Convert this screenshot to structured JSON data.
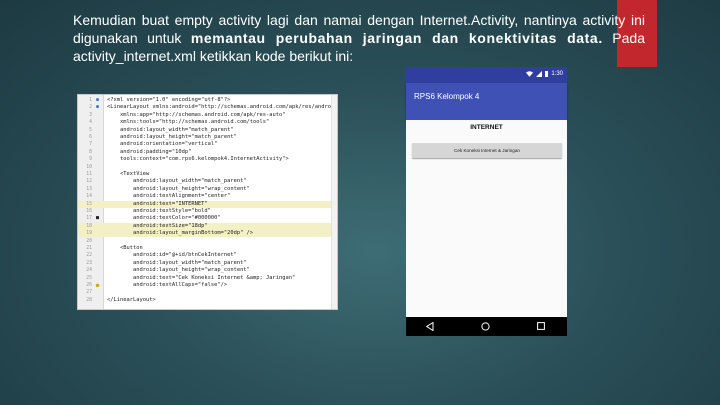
{
  "intro": {
    "line1": "Kemudian buat empty activity lagi dan namai dengan Internet.Activity, nantinya activity",
    "line2a": "ini digunakan untuk ",
    "line2b": "memantau perubahan jaringan dan konektivitas data.",
    "line2c": " Pada",
    "line3": "activity_internet.xml ketikkan kode berikut ini:"
  },
  "editor": {
    "lines": [
      {
        "n": "1",
        "text": "<?xml version=\"1.0\" encoding=\"utf-8\"?>"
      },
      {
        "n": "2",
        "text": "<LinearLayout xmlns:android=\"http://schemas.android.com/apk/res/android\""
      },
      {
        "n": "3",
        "text": "    xmlns:app=\"http://schemas.android.com/apk/res-auto\""
      },
      {
        "n": "4",
        "text": "    xmlns:tools=\"http://schemas.android.com/tools\""
      },
      {
        "n": "5",
        "text": "    android:layout_width=\"match_parent\""
      },
      {
        "n": "6",
        "text": "    android:layout_height=\"match_parent\""
      },
      {
        "n": "7",
        "text": "    android:orientation=\"vertical\""
      },
      {
        "n": "8",
        "text": "    android:padding=\"10dp\""
      },
      {
        "n": "9",
        "text": "    tools:context=\"com.rps6.kelompok4.InternetActivity\">"
      },
      {
        "n": "10",
        "text": ""
      },
      {
        "n": "11",
        "text": "    <TextView"
      },
      {
        "n": "12",
        "text": "        android:layout_width=\"match_parent\""
      },
      {
        "n": "13",
        "text": "        android:layout_height=\"wrap_content\""
      },
      {
        "n": "14",
        "text": "        android:textAlignment=\"center\""
      },
      {
        "n": "15",
        "text": "        android:text=\"INTERNET\""
      },
      {
        "n": "16",
        "text": "        android:textStyle=\"bold\""
      },
      {
        "n": "17",
        "text": "        android:textColor=\"#000000\""
      },
      {
        "n": "18",
        "text": "        android:textSize=\"18dp\""
      },
      {
        "n": "19",
        "text": "        android:layout_marginBottom=\"20dp\" />"
      },
      {
        "n": "20",
        "text": ""
      },
      {
        "n": "21",
        "text": "    <Button"
      },
      {
        "n": "22",
        "text": "        android:id=\"@+id/btnCekInternet\""
      },
      {
        "n": "23",
        "text": "        android:layout_width=\"match_parent\""
      },
      {
        "n": "24",
        "text": "        android:layout_height=\"wrap_content\""
      },
      {
        "n": "25",
        "text": "        android:text=\"Cek Koneksi Internet &amp; Jaringan\""
      },
      {
        "n": "26",
        "text": "        android:textAllCaps=\"false\"/>"
      },
      {
        "n": "27",
        "text": ""
      },
      {
        "n": "28",
        "text": "</LinearLayout>"
      }
    ]
  },
  "phone": {
    "clock": "1:30",
    "app_title": "RPS6 Kelompok 4",
    "heading": "INTERNET",
    "button_label": "Cek Koneksi Internet & Jaringan"
  },
  "colors": {
    "accent_red": "#c1272d",
    "app_bar": "#3f51b5",
    "status_bar": "#303f9f"
  }
}
